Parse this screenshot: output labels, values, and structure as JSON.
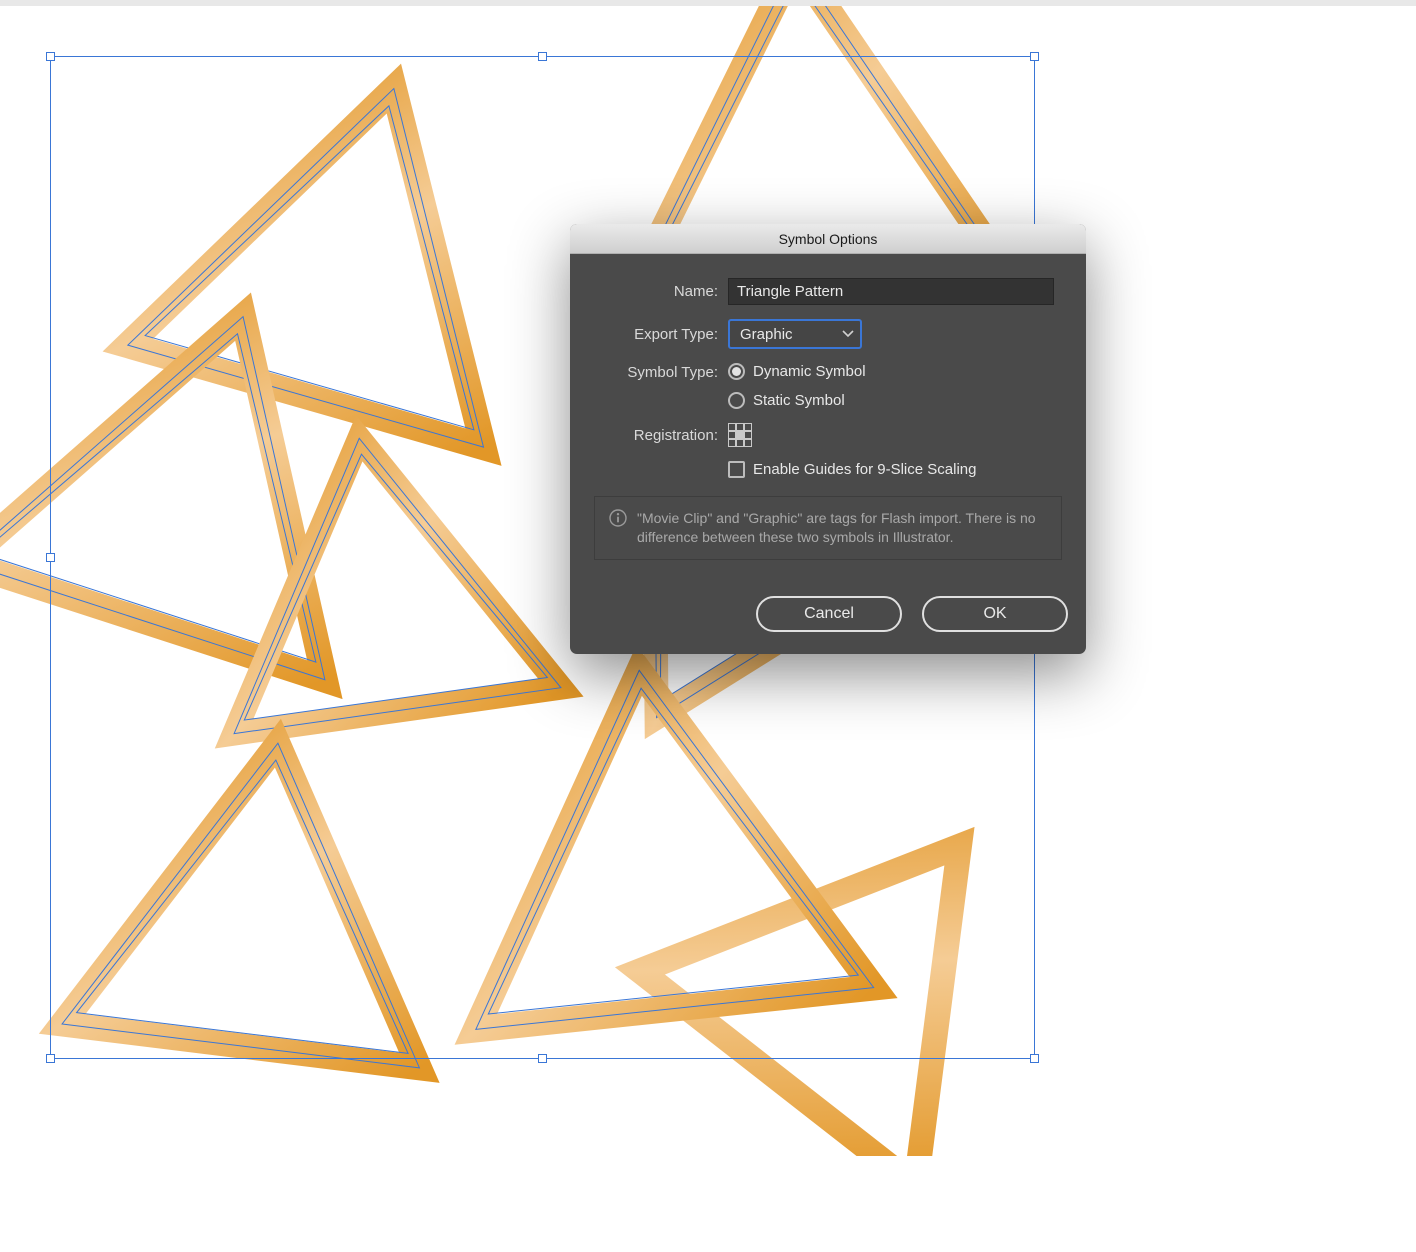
{
  "dialog": {
    "title": "Symbol Options",
    "name_label": "Name:",
    "name_value": "Triangle Pattern",
    "export_type_label": "Export Type:",
    "export_type_value": "Graphic",
    "symbol_type_label": "Symbol Type:",
    "symbol_type_options": {
      "dynamic": "Dynamic Symbol",
      "static": "Static Symbol"
    },
    "registration_label": "Registration:",
    "enable_guides_label": "Enable Guides for 9-Slice Scaling",
    "info_text": "\"Movie Clip\" and \"Graphic\" are tags for Flash import. There is no difference between these two symbols in Illustrator.",
    "cancel_label": "Cancel",
    "ok_label": "OK"
  },
  "colors": {
    "triangle_gradient_start": "#e49421",
    "triangle_gradient_end": "#f6c989",
    "selection_blue": "#3a76d6",
    "dialog_bg": "#4a4a4a",
    "input_bg": "#333333"
  }
}
